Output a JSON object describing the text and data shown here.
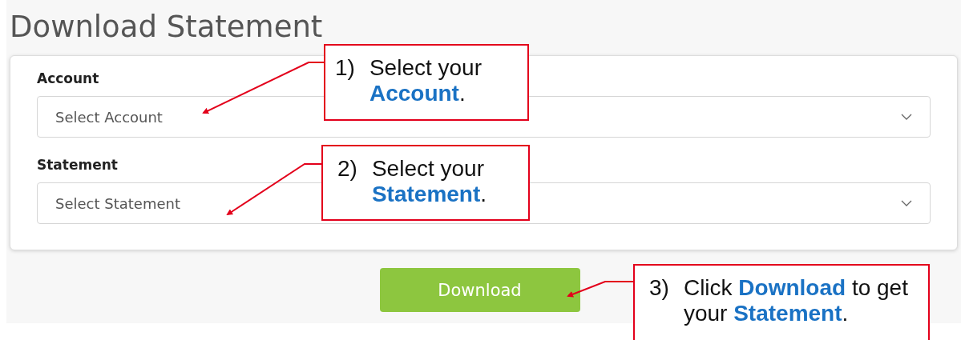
{
  "page_title": "Download Statement",
  "fields": [
    {
      "label": "Account",
      "placeholder": "Select Account"
    },
    {
      "label": "Statement",
      "placeholder": "Select Statement"
    }
  ],
  "download_button": "Download",
  "callouts": [
    {
      "number": "1)",
      "text": "Select your **Account**."
    },
    {
      "number": "2)",
      "text": "Select your **Statement**."
    },
    {
      "number": "3)",
      "text": "Click **Download** to get your **Statement**."
    }
  ]
}
